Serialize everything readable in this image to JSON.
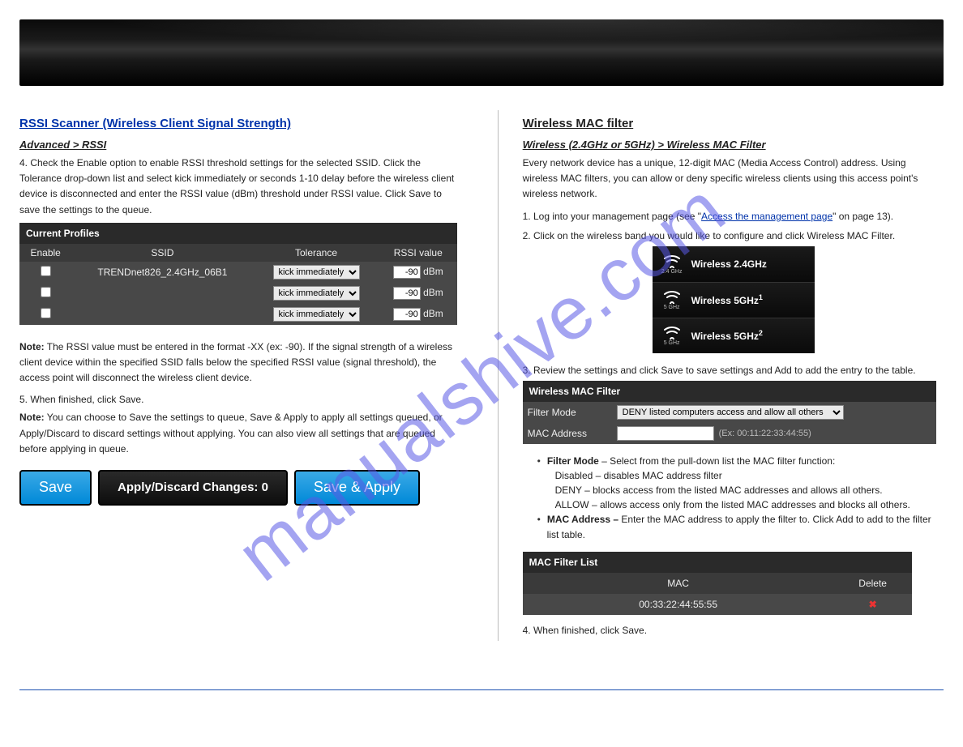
{
  "watermark": "manualshive.com",
  "left": {
    "rssi_title": "RSSI Scanner (Wireless Client Signal Strength)",
    "crumb_label": "Advanced > RSSI",
    "intro": "4. Check the Enable option to enable RSSI threshold settings for the selected SSID. Click the Tolerance drop-down list and select kick immediately or seconds 1-10 delay before the wireless client device is disconnected and enter the RSSI value (dBm) threshold under RSSI value. Click Save to save the settings to the queue.",
    "profiles": {
      "title": "Current Profiles",
      "columns": {
        "enable": "Enable",
        "ssid": "SSID",
        "tolerance": "Tolerance",
        "rssi": "RSSI value"
      },
      "tolerance_option": "kick immediately",
      "rows": [
        {
          "ssid": "TRENDnet826_2.4GHz_06B1",
          "rssi": "-90",
          "unit": "dBm"
        },
        {
          "ssid": "",
          "rssi": "-90",
          "unit": "dBm"
        },
        {
          "ssid": "",
          "rssi": "-90",
          "unit": "dBm"
        }
      ]
    },
    "note1_label": "Note:",
    "note1": " The RSSI value must be entered in the format -XX (ex: -90). If the signal strength of a wireless client device within the specified SSID falls below the specified RSSI value (signal threshold), the access point will disconnect the wireless client device.",
    "step5": "5. When finished, click Save.",
    "note2_label": "Note:",
    "note2": " You can choose to Save the settings to queue, Save & Apply to apply all settings queued, or Apply/Discard to discard settings without applying. You can also view all settings that are queued before applying in queue.",
    "buttons": {
      "save": "Save",
      "queue": "Apply/Discard Changes: 0",
      "save_apply": "Save & Apply"
    }
  },
  "right": {
    "title": "Wireless MAC filter",
    "crumb_prefix": "Wireless (2.4GHz or 5GHz) > Wireless MAC Filter",
    "intro": "Every network device has a unique, 12-digit MAC (Media Access Control) address. Using wireless MAC filters, you can allow or deny specific wireless clients using this access point's wireless network.",
    "step1": "1. Log into your management page (see \"",
    "step1_link": "Access the management page",
    "step1_tail": "\" on page 13).",
    "step2": "2. Click on the wireless band you would like to configure and click Wireless MAC Filter.",
    "bands": [
      {
        "label": "Wireless 2.4GHz",
        "sub": "2.4 GHz"
      },
      {
        "label_html": "Wireless 5GHz<sup>1</sup>",
        "sub": "5 GHz"
      },
      {
        "label_html": "Wireless 5GHz<sup>2</sup>",
        "sub": "5 GHz"
      }
    ],
    "step3": "3. Review the settings and click Save to save settings and Add to add the entry to the table.",
    "mac_filter": {
      "title": "Wireless MAC Filter",
      "mode_label": "Filter Mode",
      "mode_option": "DENY listed computers access and allow all others",
      "mac_label": "MAC Address",
      "example": "(Ex: 00:11:22:33:44:55)"
    },
    "bullets": {
      "filter_mode_label": "Filter Mode",
      "filter_mode_text": " – Select from the pull-down list the MAC filter function:",
      "disable": "Disabled – disables MAC address filter",
      "deny": "DENY – blocks access from the listed MAC addresses and allows all others.",
      "allow": "ALLOW – allows access only from the listed MAC addresses and blocks all others.",
      "mac_addr_label": "MAC Address –",
      "mac_addr_text": " Enter the MAC address to apply the filter to. Click Add to add to the filter list table."
    },
    "mac_list": {
      "title": "MAC Filter List",
      "col_mac": "MAC",
      "col_delete": "Delete",
      "rows": [
        {
          "mac": "00:33:22:44:55:55"
        }
      ]
    },
    "note4": "4. When finished, click Save."
  }
}
